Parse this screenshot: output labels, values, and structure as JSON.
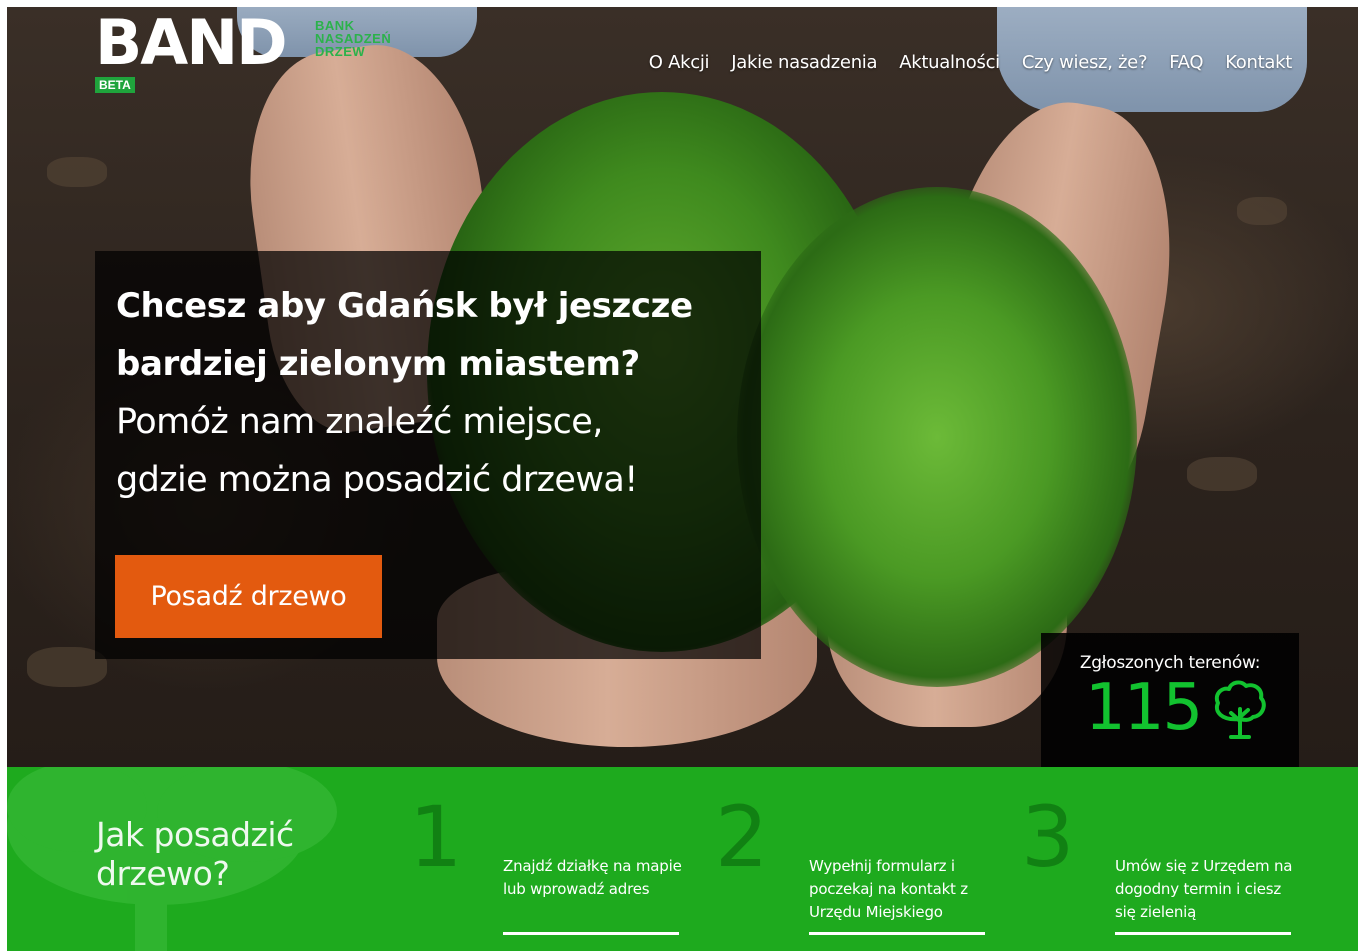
{
  "header": {
    "logo_word": "BAND",
    "logo_sub_lines": [
      "BANK",
      "NASADZEŃ",
      "DRZEW"
    ],
    "beta_badge": "BETA",
    "nav": [
      "O Akcji",
      "Jakie nasadzenia",
      "Aktualności",
      "Czy wiesz, że?",
      "FAQ",
      "Kontakt"
    ]
  },
  "hero": {
    "headline_lines": [
      "Chcesz aby Gdańsk był jeszcze",
      "bardziej zielonym miastem?"
    ],
    "subline_lines": [
      "Pomóż nam znaleźć miejsce,",
      "gdzie można posadzić drzewa!"
    ],
    "cta_label": "Posadź drzewo"
  },
  "counter": {
    "label": "Zgłoszonych terenów:",
    "value": "115",
    "icon": "tree-icon"
  },
  "steps_section": {
    "title_lines": [
      "Jak posadzić",
      "drzewo?"
    ],
    "steps": [
      {
        "number": "1",
        "text": "Znajdź działkę na mapie lub wprowadź adres"
      },
      {
        "number": "2",
        "text": "Wypełnij formularz i poczekaj na kontakt z Urzędu Miejskiego"
      },
      {
        "number": "3",
        "text": "Umów się z Urzędem na dogodny termin i ciesz się zielenią"
      }
    ]
  },
  "colors": {
    "brand_green": "#1eaa1e",
    "counter_green": "#12c22f",
    "cta_orange": "#e35a0f"
  }
}
